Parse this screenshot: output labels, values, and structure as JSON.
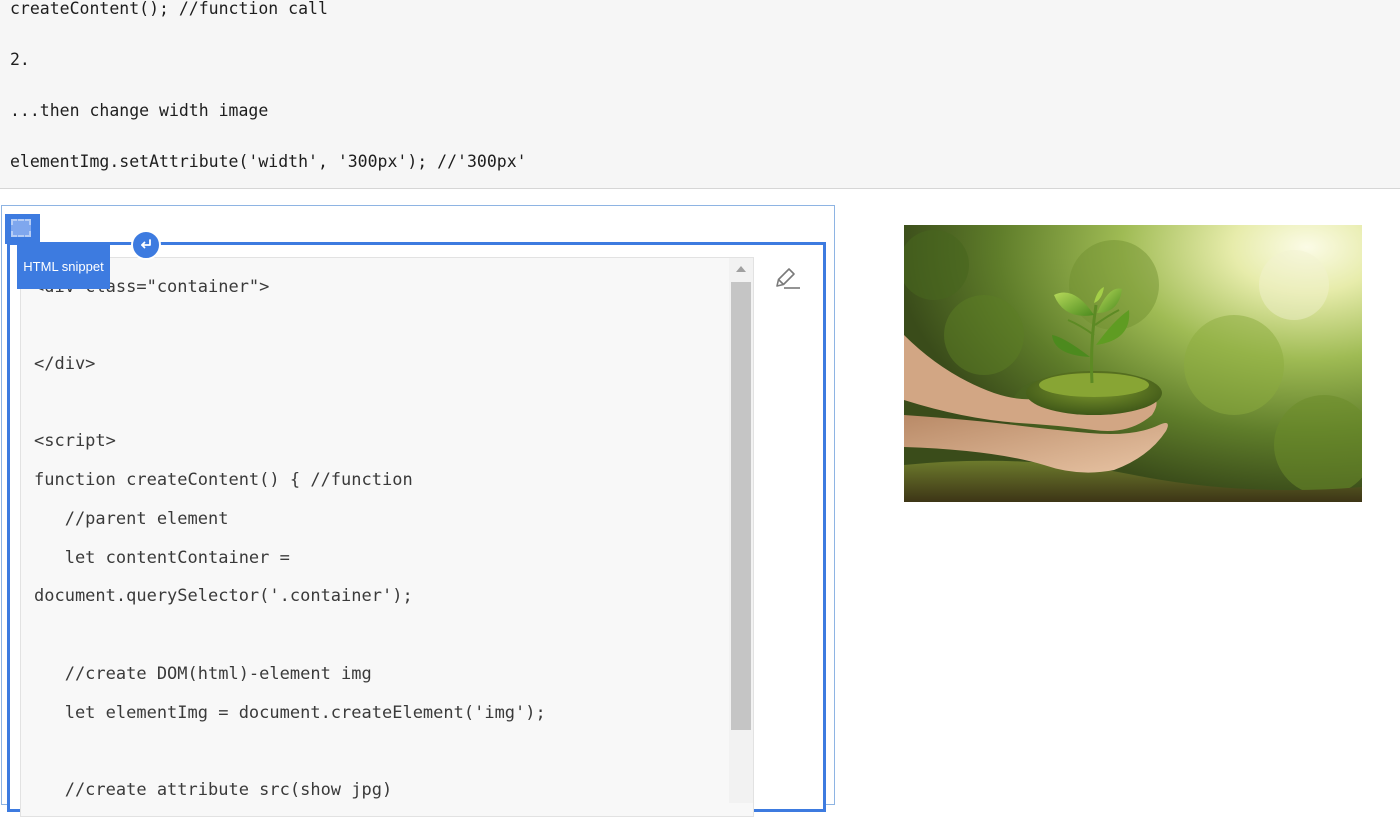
{
  "top_code": {
    "lines": [
      "createContent(); //function call",
      "2.",
      "...then change width image",
      "elementImg.setAttribute('width', '300px'); //'300px'"
    ]
  },
  "snippet": {
    "label": "HTML snippet",
    "lines": [
      "<div class=\"container\">",
      "</div>",
      "<script>",
      "function createContent() { //function",
      "   //parent element",
      "   let contentContainer =",
      "document.querySelector('.container');",
      "   //create DOM(html)-element img",
      "   let elementImg = document.createElement('img');",
      "   //create attribute src(show jpg)"
    ]
  },
  "icons": {
    "handle": "block-drag-handle-icon",
    "enter": "enter-arrow-icon",
    "edit": "pencil-icon",
    "scroll_up": "scroll-up-arrow-icon"
  },
  "colors": {
    "accent": "#3d7be0",
    "outer_border": "#8eb4e3",
    "top_background": "#f6f6f6",
    "code_background": "#f8f8f8"
  },
  "photo": {
    "subject": "hands-holding-seedling-photo"
  }
}
